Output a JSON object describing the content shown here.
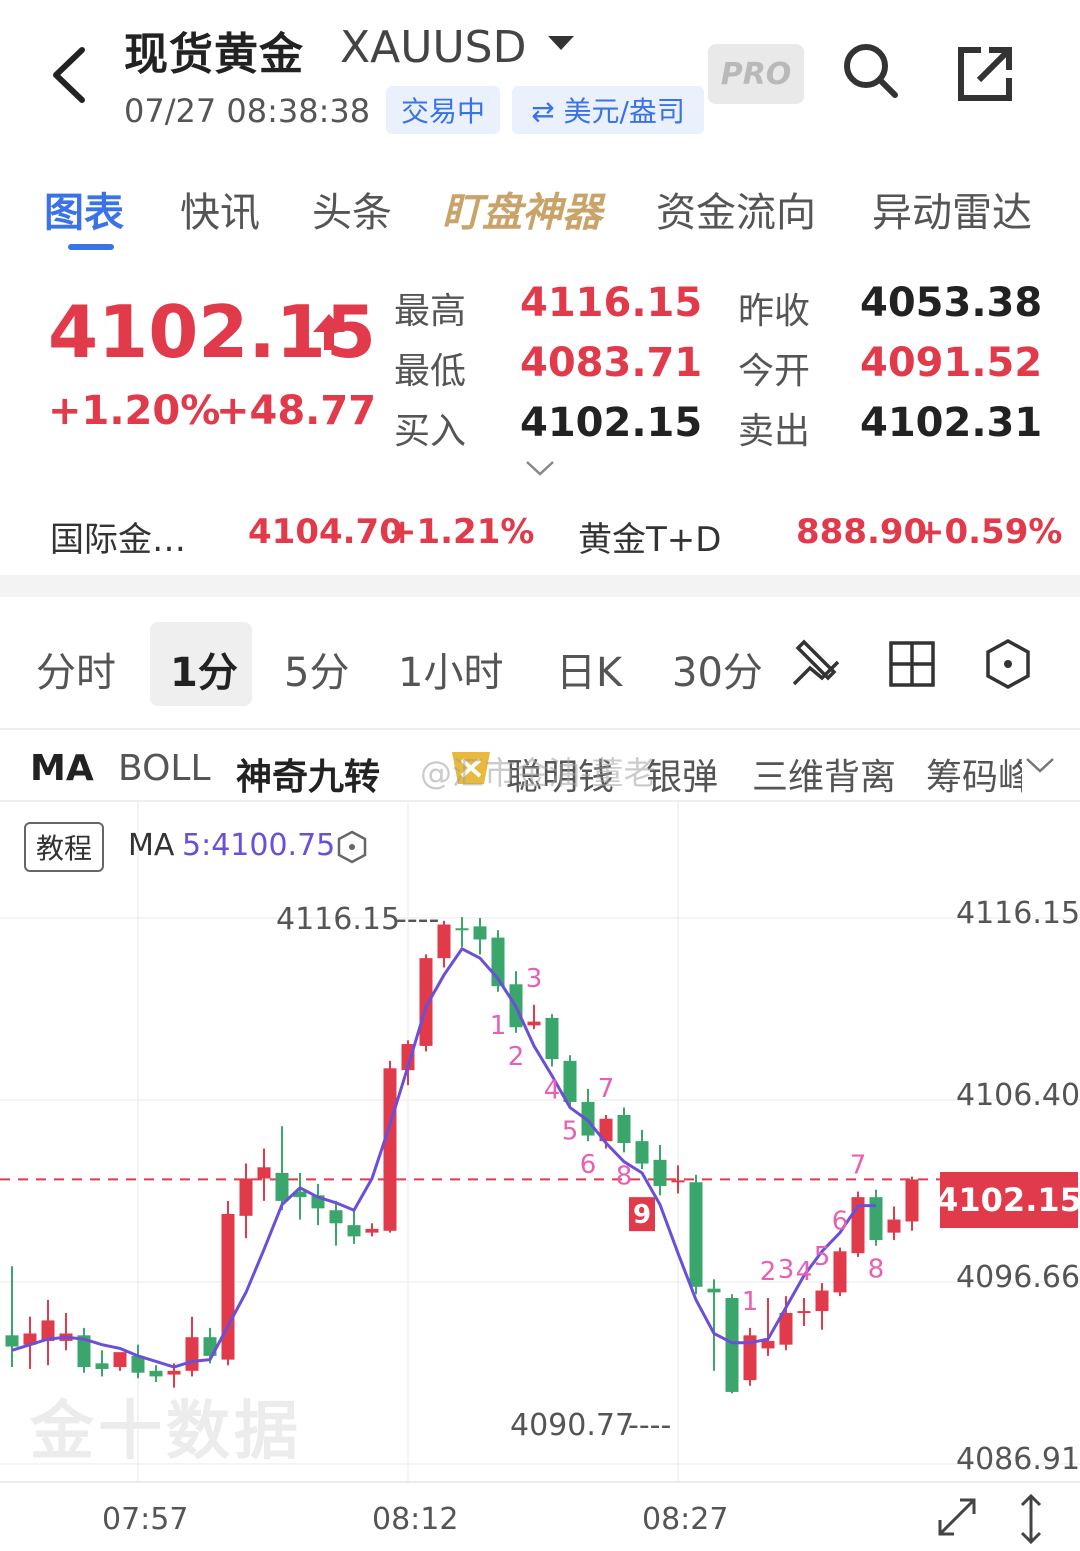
{
  "header": {
    "title": "现货黄金",
    "symbol": "XAUUSD",
    "timestamp": "07/27 08:38:38",
    "status": "交易中",
    "unit": "⇄ 美元/盎司",
    "pro_badge": "PRO"
  },
  "tabs": [
    {
      "label": "图表"
    },
    {
      "label": "快讯"
    },
    {
      "label": "头条"
    },
    {
      "label": "盯盘神器"
    },
    {
      "label": "资金流向"
    },
    {
      "label": "异动雷达"
    }
  ],
  "quote": {
    "price": "4102.15",
    "change_pct": "+1.20%",
    "change_abs": "+48.77",
    "high_label": "最高",
    "high": "4116.15",
    "low_label": "最低",
    "low": "4083.71",
    "bid_label": "买入",
    "bid": "4102.15",
    "prev_close_label": "昨收",
    "prev_close": "4053.38",
    "open_label": "今开",
    "open": "4091.52",
    "ask_label": "卖出",
    "ask": "4102.31"
  },
  "related": [
    {
      "name": "国际金…",
      "value": "4104.70",
      "change": "+1.21%"
    },
    {
      "name": "黄金T+D",
      "value": "888.90",
      "change": "+0.59%"
    }
  ],
  "periods": [
    {
      "label": "分时"
    },
    {
      "label": "1分"
    },
    {
      "label": "5分"
    },
    {
      "label": "1小时"
    },
    {
      "label": "日K"
    },
    {
      "label": "30分"
    }
  ],
  "indicators": [
    {
      "label": "MA"
    },
    {
      "label": "BOLL"
    },
    {
      "label": "神奇九转"
    },
    {
      "label": "聪明钱"
    },
    {
      "label": "银弹"
    },
    {
      "label": "三维背离"
    },
    {
      "label": "筹码峰"
    }
  ],
  "weibo_watermark": "@汇市金油-董老",
  "chart_header": {
    "tutorial": "教程",
    "ma_label": "MA",
    "ma_value": "5:4100.75"
  },
  "chart_data": {
    "type": "candlestick",
    "y_axis_labels": [
      "4116.15",
      "4106.40",
      "4096.66",
      "4086.91"
    ],
    "x_axis_labels": [
      "07:57",
      "08:12",
      "08:27"
    ],
    "high_marker": "4116.15",
    "low_marker": "4090.77",
    "current_price": "4102.15",
    "ylim": [
      4086.91,
      4116.15
    ],
    "ma5_color": "#6b4fd8",
    "up_color": "#e03a4b",
    "down_color": "#3aa66b",
    "candles": [
      {
        "o": 4093.8,
        "h": 4097.5,
        "c": 4093.2,
        "l": 4092.1
      },
      {
        "o": 4093.3,
        "h": 4094.8,
        "c": 4093.9,
        "l": 4092.0
      },
      {
        "o": 4093.5,
        "h": 4095.7,
        "c": 4094.6,
        "l": 4092.2
      },
      {
        "o": 4093.5,
        "h": 4095.0,
        "c": 4093.9,
        "l": 4093.0
      },
      {
        "o": 4093.8,
        "h": 4094.2,
        "c": 4092.1,
        "l": 4091.8
      },
      {
        "o": 4092.3,
        "h": 4093.0,
        "c": 4092.0,
        "l": 4091.6
      },
      {
        "o": 4092.1,
        "h": 4092.8,
        "c": 4092.9,
        "l": 4091.9
      },
      {
        "o": 4092.7,
        "h": 4093.3,
        "c": 4091.8,
        "l": 4091.5
      },
      {
        "o": 4091.9,
        "h": 4092.2,
        "c": 4091.6,
        "l": 4091.3
      },
      {
        "o": 4091.7,
        "h": 4092.3,
        "c": 4091.9,
        "l": 4091.0
      },
      {
        "o": 4091.9,
        "h": 4094.8,
        "c": 4093.7,
        "l": 4091.6
      },
      {
        "o": 4093.7,
        "h": 4094.2,
        "c": 4092.7,
        "l": 4092.3
      },
      {
        "o": 4092.5,
        "h": 4101.0,
        "c": 4100.3,
        "l": 4092.2
      },
      {
        "o": 4100.2,
        "h": 4103.0,
        "c": 4102.2,
        "l": 4099.0
      },
      {
        "o": 4102.2,
        "h": 4103.8,
        "c": 4102.8,
        "l": 4101.0
      },
      {
        "o": 4102.5,
        "h": 4105.0,
        "c": 4101.0,
        "l": 4100.5
      },
      {
        "o": 4101.5,
        "h": 4102.5,
        "c": 4101.2,
        "l": 4100.0
      },
      {
        "o": 4101.3,
        "h": 4101.9,
        "c": 4100.6,
        "l": 4099.7
      },
      {
        "o": 4100.5,
        "h": 4101.0,
        "c": 4099.8,
        "l": 4098.6
      },
      {
        "o": 4099.7,
        "h": 4100.5,
        "c": 4099.1,
        "l": 4098.7
      },
      {
        "o": 4099.3,
        "h": 4099.8,
        "c": 4099.5,
        "l": 4099.1
      },
      {
        "o": 4099.4,
        "h": 4108.5,
        "c": 4108.1,
        "l": 4099.3
      },
      {
        "o": 4108.0,
        "h": 4109.6,
        "c": 4109.4,
        "l": 4107.2
      },
      {
        "o": 4109.3,
        "h": 4114.2,
        "c": 4114.0,
        "l": 4109.0
      },
      {
        "o": 4114.0,
        "h": 4116.0,
        "c": 4115.8,
        "l": 4113.5
      },
      {
        "o": 4115.6,
        "h": 4116.2,
        "c": 4115.5,
        "l": 4114.6
      },
      {
        "o": 4115.7,
        "h": 4116.15,
        "c": 4115.0,
        "l": 4114.2
      },
      {
        "o": 4115.1,
        "h": 4115.5,
        "c": 4112.5,
        "l": 4112.2
      },
      {
        "o": 4112.6,
        "h": 4113.3,
        "c": 4110.3,
        "l": 4110.0
      },
      {
        "o": 4110.4,
        "h": 4111.5,
        "c": 4110.6,
        "l": 4110.2
      },
      {
        "o": 4110.8,
        "h": 4111.0,
        "c": 4108.6,
        "l": 4108.2
      },
      {
        "o": 4108.5,
        "h": 4108.8,
        "c": 4106.3,
        "l": 4106.0
      },
      {
        "o": 4106.3,
        "h": 4107.0,
        "c": 4104.5,
        "l": 4104.2
      },
      {
        "o": 4104.2,
        "h": 4105.6,
        "c": 4105.4,
        "l": 4103.8
      },
      {
        "o": 4105.6,
        "h": 4106.0,
        "c": 4104.1,
        "l": 4103.6
      },
      {
        "o": 4104.2,
        "h": 4104.8,
        "c": 4103.0,
        "l": 4102.7
      },
      {
        "o": 4103.2,
        "h": 4104.0,
        "c": 4101.8,
        "l": 4101.3
      },
      {
        "o": 4102.0,
        "h": 4102.9,
        "c": 4102.1,
        "l": 4101.4
      },
      {
        "o": 4102.0,
        "h": 4102.4,
        "c": 4096.4,
        "l": 4096.0
      },
      {
        "o": 4096.3,
        "h": 4096.8,
        "c": 4096.1,
        "l": 4091.9
      },
      {
        "o": 4095.8,
        "h": 4096.0,
        "c": 4090.77,
        "l": 4090.7
      },
      {
        "o": 4091.4,
        "h": 4094.2,
        "c": 4093.8,
        "l": 4091.1
      },
      {
        "o": 4093.1,
        "h": 4095.8,
        "c": 4093.5,
        "l": 4092.7
      },
      {
        "o": 4093.3,
        "h": 4095.9,
        "c": 4095.0,
        "l": 4093.0
      },
      {
        "o": 4095.0,
        "h": 4095.8,
        "c": 4095.1,
        "l": 4094.3
      },
      {
        "o": 4095.1,
        "h": 4096.6,
        "c": 4096.2,
        "l": 4094.1
      },
      {
        "o": 4096.1,
        "h": 4098.5,
        "c": 4098.3,
        "l": 4095.9
      },
      {
        "o": 4098.2,
        "h": 4101.5,
        "c": 4101.2,
        "l": 4098.0
      },
      {
        "o": 4101.2,
        "h": 4101.6,
        "c": 4098.9,
        "l": 4098.6
      },
      {
        "o": 4099.3,
        "h": 4100.7,
        "c": 4100.0,
        "l": 4098.9
      },
      {
        "o": 4099.9,
        "h": 4102.3,
        "c": 4102.15,
        "l": 4099.4
      }
    ],
    "ma5": [
      4093.0,
      4093.3,
      4093.6,
      4093.7,
      4093.6,
      4093.3,
      4093.1,
      4092.7,
      4092.4,
      4092.1,
      4092.4,
      4092.5,
      4094.3,
      4096.1,
      4098.4,
      4100.8,
      4101.7,
      4101.2,
      4100.9,
      4100.5,
      4102.2,
      4105.1,
      4108.2,
      4111.4,
      4113.1,
      4114.5,
      4114.0,
      4112.9,
      4111.4,
      4109.3,
      4107.7,
      4106.0,
      4105.3,
      4104.1,
      4103.1,
      4102.5,
      4100.8,
      4098.2,
      4095.7,
      4093.9,
      4093.4,
      4093.4,
      4093.6,
      4095.3,
      4097.0,
      4098.3,
      4099.3,
      4100.75,
      4100.75
    ],
    "tdseq_labels": [
      "1",
      "2",
      "3",
      "4",
      "5",
      "6",
      "7",
      "8",
      "9",
      "1",
      "2",
      "3",
      "4",
      "5",
      "6",
      "7",
      "8"
    ]
  },
  "watermark": "金十数据"
}
